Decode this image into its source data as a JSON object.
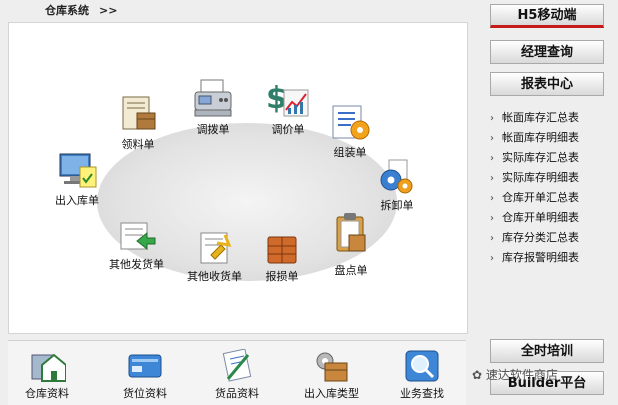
{
  "header": {
    "title": "仓库系统",
    "arrows": ">>"
  },
  "flow_nodes": {
    "lingliao": "领料单",
    "diaobo": "调拨单",
    "tiaojia": "调价单",
    "zuzhuang": "组装单",
    "chaixie": "拆卸单",
    "churuku": "出入库单",
    "qitafahuo": "其他发货单",
    "qitashouhuo": "其他收货单",
    "baosun": "报损单",
    "pandian": "盘点单"
  },
  "bottom_items": [
    "仓库资料",
    "货位资料",
    "货品资料",
    "出入库类型",
    "业务查找"
  ],
  "right_buttons": {
    "h5": "H5移动端",
    "manager": "经理查询",
    "report_center": "报表中心",
    "training": "全时培训",
    "builder": "Builder平台"
  },
  "report_items": [
    "帐面库存汇总表",
    "帐面库存明细表",
    "实际库存汇总表",
    "实际库存明细表",
    "仓库开单汇总表",
    "仓库开单明细表",
    "库存分类汇总表",
    "库存报警明细表"
  ],
  "watermark": "速达软件商店",
  "colors": {
    "accent_red": "#c61a1a",
    "panel_border": "#d4d4d4"
  }
}
